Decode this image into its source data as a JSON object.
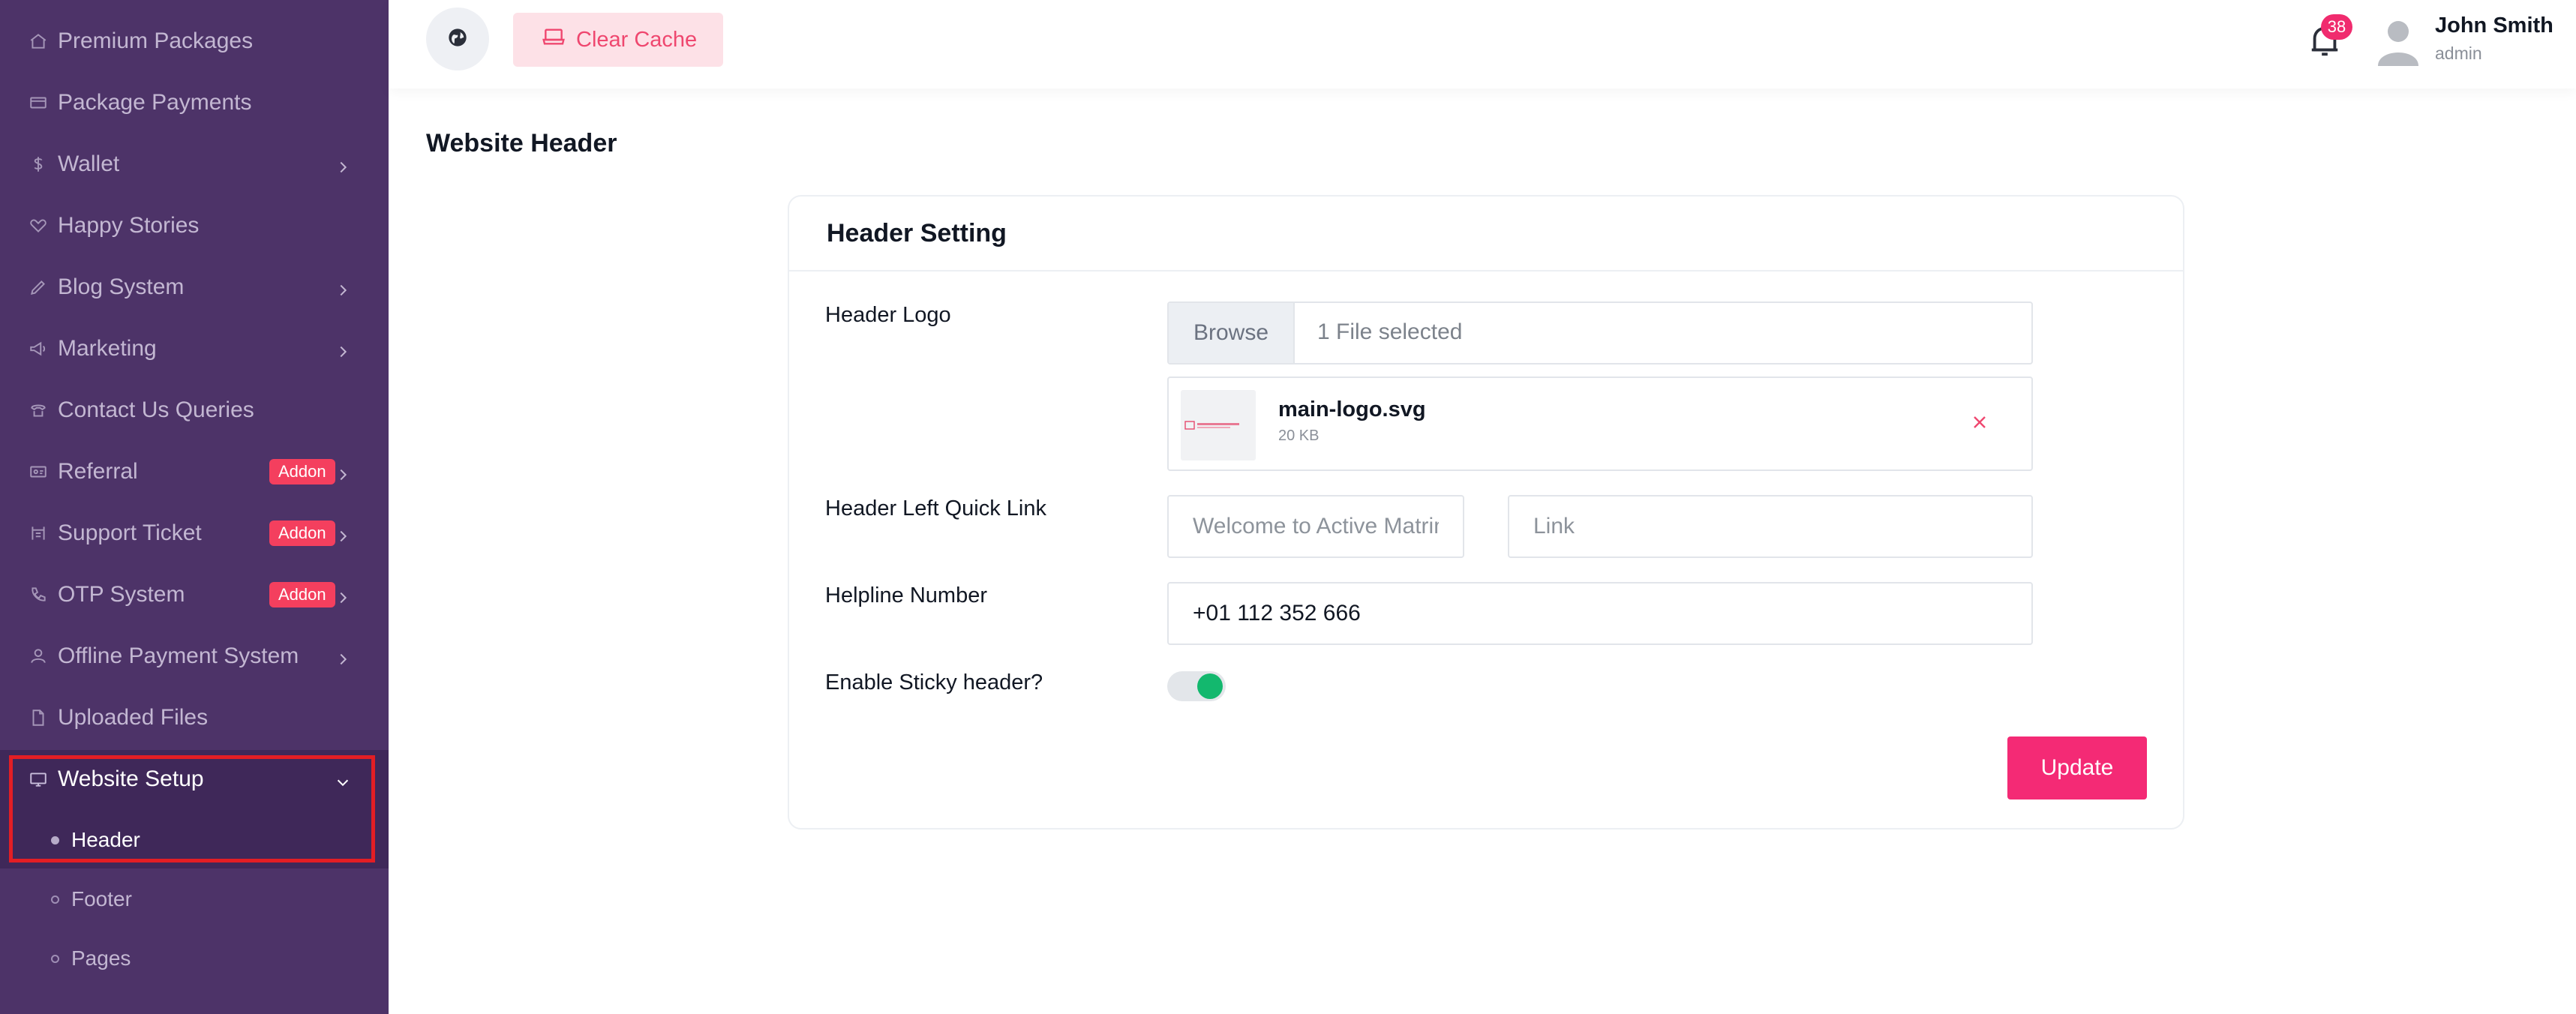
{
  "sidebar": {
    "items": [
      {
        "label": "Premium Packages",
        "icon": "home-icon"
      },
      {
        "label": "Package Payments",
        "icon": "card-icon"
      },
      {
        "label": "Wallet",
        "icon": "dollar-icon"
      },
      {
        "label": "Happy Stories",
        "icon": "heart-icon"
      },
      {
        "label": "Blog System",
        "icon": "pen-icon"
      },
      {
        "label": "Marketing",
        "icon": "megaphone-icon"
      },
      {
        "label": "Contact Us Queries",
        "icon": "contact-icon"
      },
      {
        "label": "Referral",
        "icon": "referral-icon",
        "badge": "Addon"
      },
      {
        "label": "Support Ticket",
        "icon": "ticket-icon",
        "badge": "Addon"
      },
      {
        "label": "OTP System",
        "icon": "phone-icon",
        "badge": "Addon"
      },
      {
        "label": "Offline Payment System",
        "icon": "user-icon"
      },
      {
        "label": "Uploaded Files",
        "icon": "file-icon"
      },
      {
        "label": "Website Setup",
        "icon": "monitor-icon",
        "expanded": true
      }
    ],
    "subitems": [
      {
        "label": "Header",
        "current": true
      },
      {
        "label": "Footer"
      },
      {
        "label": "Pages"
      }
    ]
  },
  "topbar": {
    "clear_cache_label": "Clear Cache",
    "notification_count": "38",
    "user_name": "John Smith",
    "user_role": "admin"
  },
  "page": {
    "title": "Website Header"
  },
  "card": {
    "title": "Header Setting",
    "logo_label": "Header Logo",
    "browse_label": "Browse",
    "file_selected": "1 File selected",
    "file_name": "main-logo.svg",
    "file_size": "20 KB",
    "quick_link_label": "Header Left Quick Link",
    "quick_link_text_placeholder": "Welcome to Active Matrimony",
    "quick_link_url_placeholder": "Link",
    "helpline_label": "Helpline Number",
    "helpline_value": "+01 112 352 666",
    "sticky_label": "Enable Sticky header?",
    "sticky_enabled": true,
    "update_label": "Update"
  },
  "colors": {
    "sidebar_bg": "#4d3368",
    "accent_pink": "#f42a75",
    "toggle_on": "#13b86e",
    "addon_badge": "#f43f5e"
  }
}
